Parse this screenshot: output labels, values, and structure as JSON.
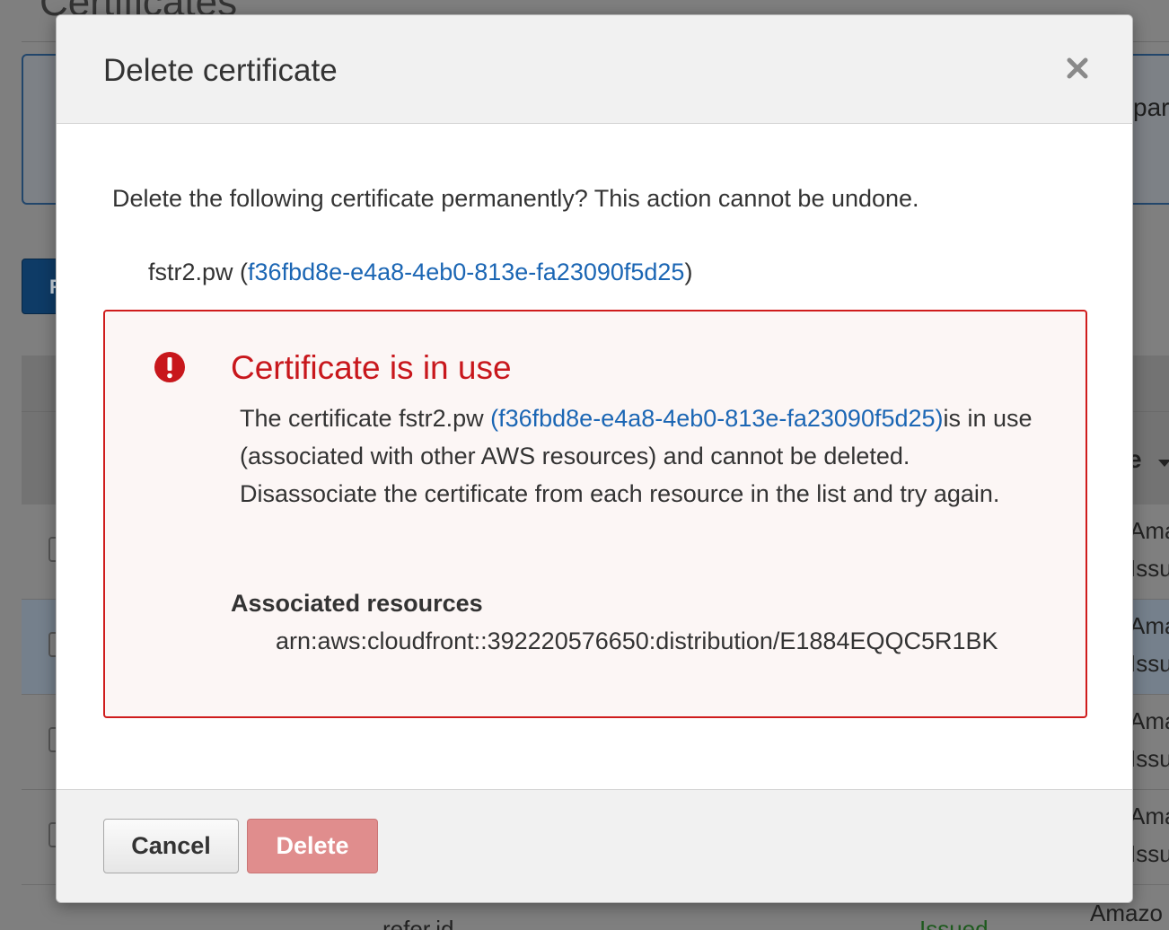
{
  "background": {
    "page_title": "Certificates",
    "info_panel_text": "pare",
    "primary_button_text": "R",
    "sort_column_label": "e",
    "rows": [
      {
        "line1": "Amazo",
        "line2": "Issued"
      },
      {
        "line1": "Amazo",
        "line2": "Issued"
      },
      {
        "line1": "Amazo",
        "line2": "Issued"
      },
      {
        "line1": "Amazo",
        "line2": "Issued"
      }
    ],
    "bottom_row": {
      "name": "refer.id",
      "status": "Issued",
      "type": "Amazo"
    }
  },
  "modal": {
    "title": "Delete certificate",
    "confirm_text": "Delete the following certificate permanently? This action cannot be undone.",
    "certificate": {
      "domain": "fstr2.pw",
      "id": "f36fbd8e-e4a8-4eb0-813e-fa23090f5d25"
    },
    "error": {
      "title": "Certificate is in use",
      "message_prefix": "The certificate fstr2.pw ",
      "message_link": "(f36fbd8e-e4a8-4eb0-813e-fa23090f5d25)",
      "message_suffix": "is in use (associated with other AWS resources) and cannot be deleted. Disassociate the certificate from each resource in the list and try again.",
      "associated_title": "Associated resources",
      "associated_resources": [
        "arn:aws:cloudfront::392220576650:distribution/E1884EQQC5R1BK"
      ]
    },
    "buttons": {
      "cancel": "Cancel",
      "delete": "Delete"
    }
  },
  "colors": {
    "link": "#1b66b4",
    "error": "#c8171c",
    "error_bg": "#fcf6f5",
    "delete_disabled": "#e08d8d"
  }
}
